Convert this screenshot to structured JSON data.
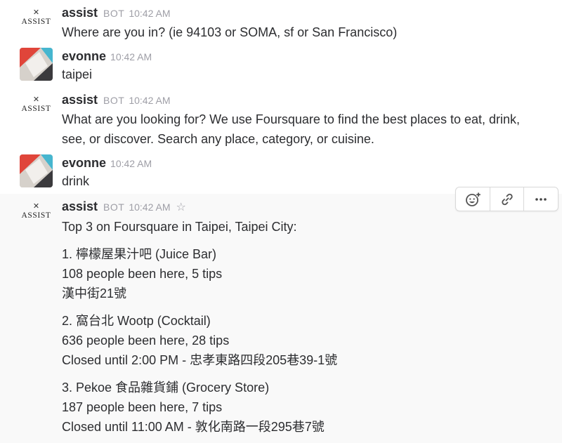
{
  "messages": [
    {
      "name": "assist",
      "badge": "BOT",
      "time": "10:42 AM",
      "avatar": "assist-logo",
      "lines": [
        "Where are you in? (ie 94103 or SOMA, sf or San Francisco)"
      ]
    },
    {
      "name": "evonne",
      "time": "10:42 AM",
      "avatar": "evonne-avatar",
      "lines": [
        "taipei"
      ]
    },
    {
      "name": "assist",
      "badge": "BOT",
      "time": "10:42 AM",
      "avatar": "assist-logo",
      "lines": [
        "What are you looking for? We use Foursquare to find the best places to eat, drink,",
        "see, or discover. Search any place, category, or cuisine."
      ]
    },
    {
      "name": "evonne",
      "time": "10:42 AM",
      "avatar": "evonne-avatar",
      "lines": [
        "drink"
      ]
    },
    {
      "name": "assist",
      "badge": "BOT",
      "time": "10:42 AM",
      "avatar": "assist-logo",
      "star": "☆",
      "intro": "Top 3 on Foursquare in Taipei, Taipei City:",
      "results": [
        {
          "title": "1. 檸檬屋果汁吧 (Juice Bar)",
          "stats": "108 people been here, 5 tips",
          "detail": "漢中街21號"
        },
        {
          "title": "2. 窩台北 Wootp (Cocktail)",
          "stats": "636 people been here, 28 tips",
          "detail": "Closed until 2:00 PM - 忠孝東路四段205巷39-1號"
        },
        {
          "title": "3. Pekoe 食品雜貨鋪 (Grocery Store)",
          "stats": "187 people been here, 7 tips",
          "detail": "Closed until 11:00 AM - 敦化南路一段295巷7號"
        }
      ]
    }
  ],
  "assist_logo": {
    "mark": "✕",
    "word": "ASSIST"
  },
  "actions": [
    {
      "name": "add-reaction",
      "icon": "add-reaction-icon"
    },
    {
      "name": "copy-link",
      "icon": "link-icon"
    },
    {
      "name": "more-actions",
      "icon": "more-icon"
    }
  ],
  "colors": {
    "text": "#2c2d30",
    "muted": "#9e9ea6",
    "hover_bg": "#f9f9f9",
    "evonne_red": "#e0453a",
    "evonne_teal": "#46b6cf",
    "evonne_dark": "#3b3a3d"
  }
}
